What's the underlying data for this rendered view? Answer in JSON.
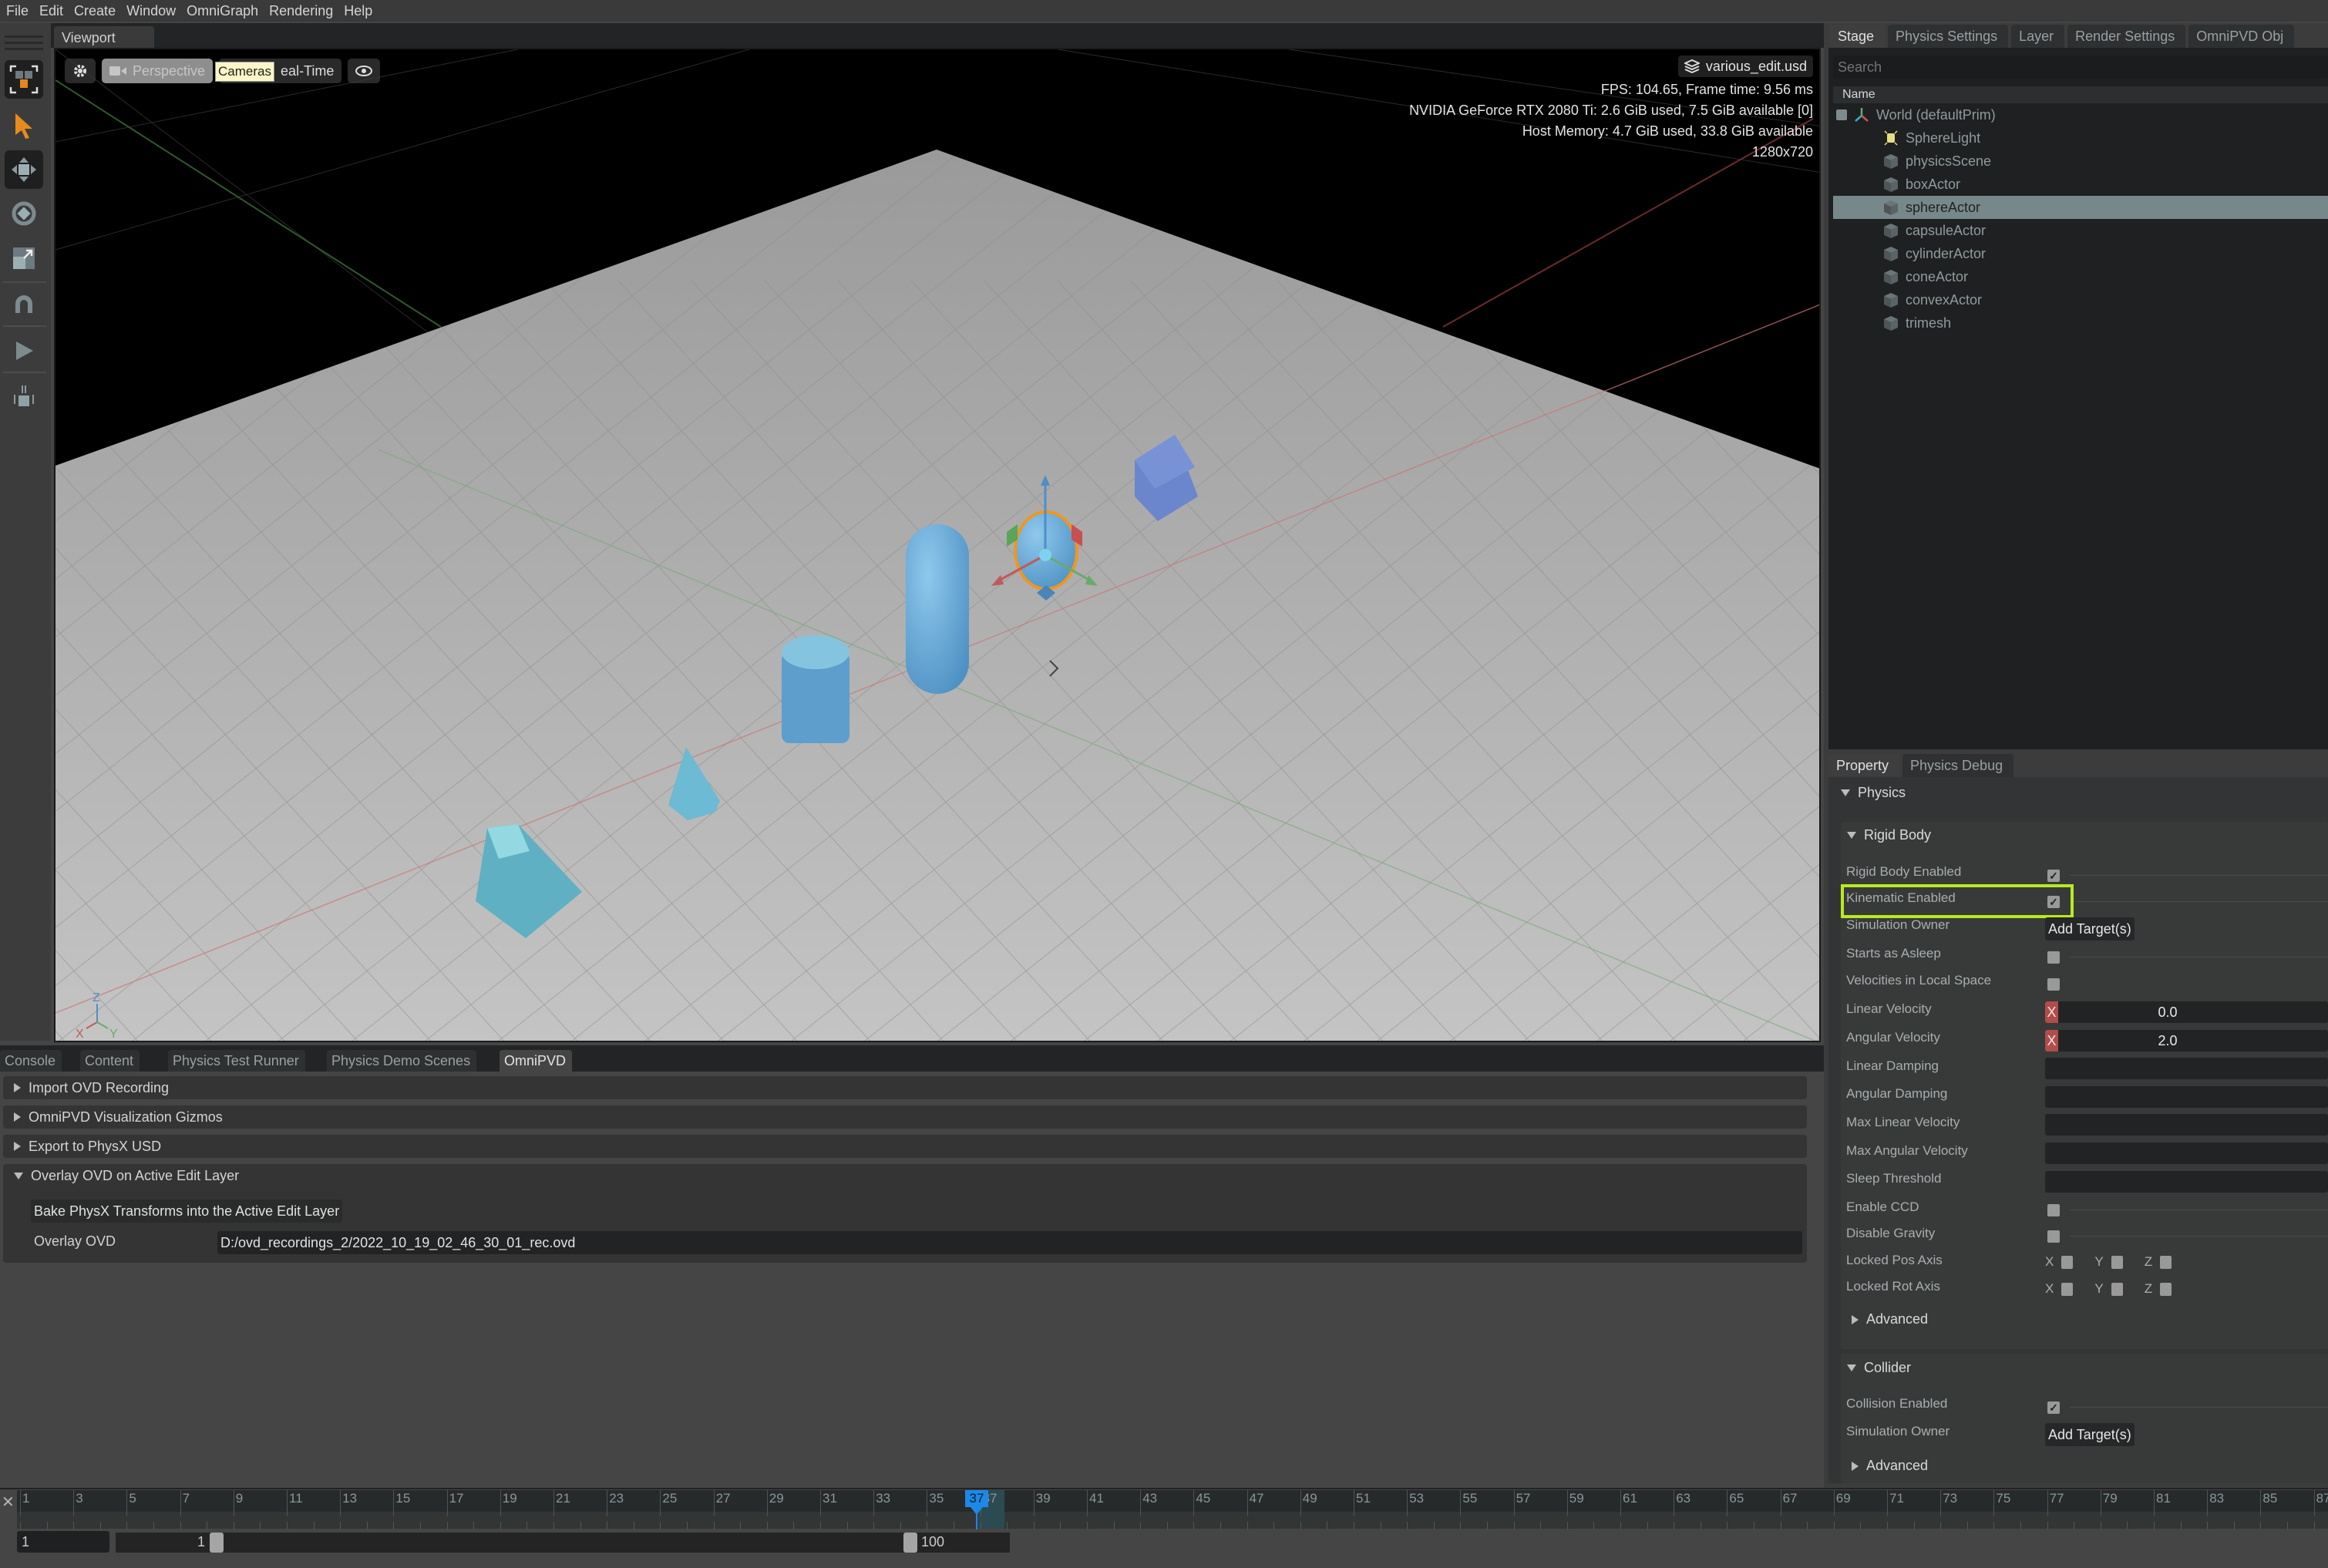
{
  "menu": [
    "File",
    "Edit",
    "Create",
    "Window",
    "OmniGraph",
    "Rendering",
    "Help"
  ],
  "toolbar": {
    "icons": [
      "select-mode-icon",
      "select-arrow-icon",
      "move-icon",
      "rotate-icon",
      "scale-icon",
      "snap-magnet-icon",
      "play-icon",
      "drop-physics-icon"
    ]
  },
  "viewport": {
    "tab_label": "Viewport",
    "camera_label": "Perspective",
    "render_mode_label": "eal-Time",
    "tooltip": "Cameras",
    "stage_file": "various_edit.usd",
    "stats": [
      "FPS: 104.65, Frame time: 9.56 ms",
      "NVIDIA GeForce RTX 2080 Ti: 2.6 GiB used,  7.5 GiB available [0]",
      "Host Memory: 4.7 GiB used, 33.8 GiB available",
      "1280x720"
    ],
    "axis_labels": {
      "x": "X",
      "y": "Y",
      "z": "Z"
    }
  },
  "right_panel": {
    "tabs": [
      "Stage",
      "Physics Settings",
      "Layer",
      "Render Settings",
      "OmniPVD Obj"
    ],
    "active_tab": "Stage",
    "search_placeholder": "Search",
    "column_header": "Name",
    "tree": {
      "root": "World (defaultPrim)",
      "children": [
        {
          "name": "SphereLight",
          "icon": "light-icon",
          "selected": false
        },
        {
          "name": "physicsScene",
          "icon": "prim-cube-icon",
          "selected": false
        },
        {
          "name": "boxActor",
          "icon": "prim-cube-icon",
          "selected": false
        },
        {
          "name": "sphereActor",
          "icon": "prim-cube-icon",
          "selected": true
        },
        {
          "name": "capsuleActor",
          "icon": "prim-cube-icon",
          "selected": false
        },
        {
          "name": "cylinderActor",
          "icon": "prim-cube-icon",
          "selected": false
        },
        {
          "name": "coneActor",
          "icon": "prim-cube-icon",
          "selected": false
        },
        {
          "name": "convexActor",
          "icon": "prim-cube-icon",
          "selected": false
        },
        {
          "name": "trimesh",
          "icon": "prim-cube-icon",
          "selected": false
        }
      ]
    }
  },
  "property_panel": {
    "tabs": [
      "Property",
      "Physics Debug"
    ],
    "active_tab": "Property",
    "physics_header": "Physics",
    "rigid_body": {
      "header": "Rigid Body",
      "rows": {
        "rigid_body_enabled": {
          "label": "Rigid Body Enabled",
          "checked": true
        },
        "kinematic_enabled": {
          "label": "Kinematic Enabled",
          "checked": true
        },
        "simulation_owner": {
          "label": "Simulation Owner",
          "button": "Add Target(s)"
        },
        "starts_as_asleep": {
          "label": "Starts as Asleep",
          "checked": false
        },
        "velocities_local": {
          "label": "Velocities in Local Space",
          "checked": false
        },
        "linear_velocity": {
          "label": "Linear Velocity",
          "axis": "X",
          "value": "0.0"
        },
        "angular_velocity": {
          "label": "Angular Velocity",
          "axis": "X",
          "value": "2.0"
        },
        "linear_damping": {
          "label": "Linear Damping",
          "value": ""
        },
        "angular_damping": {
          "label": "Angular Damping",
          "value": ""
        },
        "max_linear_velocity": {
          "label": "Max Linear Velocity",
          "value": ""
        },
        "max_angular_velocity": {
          "label": "Max Angular Velocity",
          "value": ""
        },
        "sleep_threshold": {
          "label": "Sleep Threshold",
          "value": ""
        },
        "enable_ccd": {
          "label": "Enable CCD",
          "checked": false
        },
        "disable_gravity": {
          "label": "Disable Gravity",
          "checked": false
        },
        "locked_pos_axis": {
          "label": "Locked Pos Axis",
          "axes": [
            "X",
            "Y",
            "Z"
          ]
        },
        "locked_rot_axis": {
          "label": "Locked Rot Axis",
          "axes": [
            "X",
            "Y",
            "Z"
          ]
        }
      },
      "advanced": "Advanced"
    },
    "collider": {
      "header": "Collider",
      "collision_enabled": {
        "label": "Collision Enabled",
        "checked": true
      },
      "simulation_owner": {
        "label": "Simulation Owner",
        "button": "Add Target(s)"
      },
      "advanced": "Advanced"
    },
    "highlight_color": "#b7ea1f"
  },
  "bottom_panel": {
    "tabs": [
      "Console",
      "Content",
      "Physics Test Runner",
      "Physics Demo Scenes",
      "OmniPVD"
    ],
    "active_tab": "OmniPVD",
    "sections": [
      {
        "label": "Import OVD Recording",
        "expanded": false
      },
      {
        "label": "OmniPVD Visualization Gizmos",
        "expanded": false
      },
      {
        "label": "Export to PhysX USD",
        "expanded": false
      },
      {
        "label": "Overlay OVD on Active Edit Layer",
        "expanded": true
      }
    ],
    "bake_button": "Bake PhysX Transforms into the Active Edit Layer",
    "overlay_label": "Overlay OVD",
    "overlay_path": "D:/ovd_recordings_2/2022_10_19_02_46_30_01_rec.ovd"
  },
  "timeline": {
    "tick_labels": [
      "1",
      "3",
      "5",
      "7",
      "9",
      "11",
      "13",
      "15",
      "17",
      "19",
      "21",
      "23",
      "25",
      "27",
      "29",
      "31",
      "33",
      "35",
      "37",
      "39",
      "41",
      "43",
      "45",
      "47",
      "49",
      "51",
      "53",
      "55",
      "57",
      "59",
      "61",
      "63",
      "65",
      "67",
      "69",
      "71",
      "73",
      "75",
      "77",
      "79",
      "81",
      "83",
      "85",
      "87"
    ],
    "current_frame": "37",
    "start_field": "1",
    "range_start": "1",
    "range_end": "100",
    "playhead_color": "#1e88e6"
  }
}
